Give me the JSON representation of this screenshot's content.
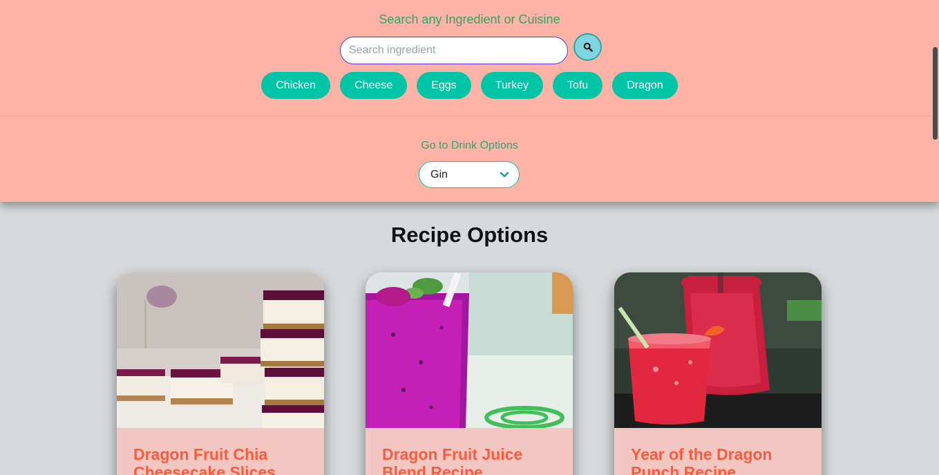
{
  "search": {
    "label": "Search any Ingredient or Cuisine",
    "placeholder": "Search ingredient",
    "value": ""
  },
  "chips": [
    "Chicken",
    "Cheese",
    "Eggs",
    "Turkey",
    "Tofu",
    "Dragon"
  ],
  "drinks": {
    "label": "Go to Drink Options",
    "selected": "Gin"
  },
  "recipes": {
    "heading": "Recipe Options",
    "cards": [
      {
        "title": "Dragon Fruit Chia Cheesecake Slices"
      },
      {
        "title": "Dragon Fruit Juice Blend Recipe"
      },
      {
        "title": "Year of the Dragon Punch Recipe"
      }
    ]
  },
  "colors": {
    "header_bg": "#ffb3a7",
    "accent_green": "#2fa36b",
    "chip_teal": "#00c4a6",
    "title_orange": "#ff5a3c"
  }
}
